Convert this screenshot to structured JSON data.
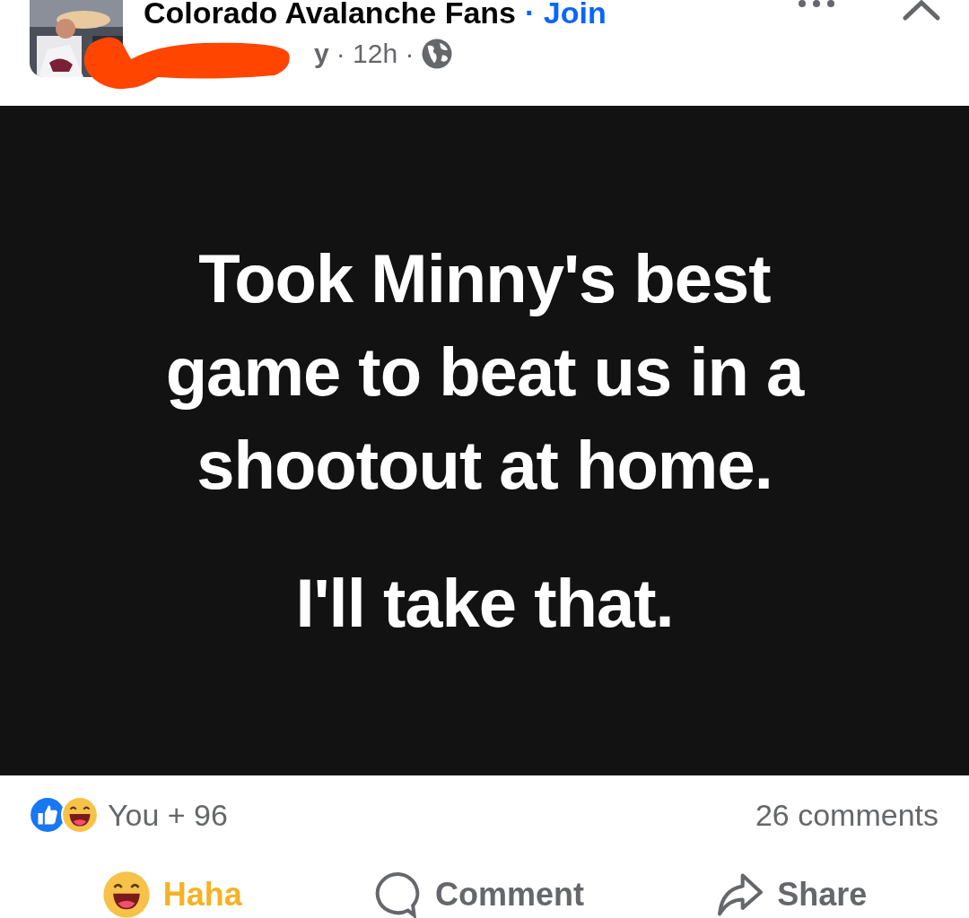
{
  "header": {
    "group_name": "Colorado Avalanche Fans",
    "join_link": "· Join",
    "author_visible": "y",
    "time": "· 12h ·"
  },
  "post": {
    "lines": [
      "Took Minny's best game to beat us in a shootout at home.",
      "I'll take that."
    ]
  },
  "reactions": {
    "summary": "You + 96",
    "comments": "26 comments"
  },
  "actions": [
    {
      "kind": "reaction",
      "label": "Haha",
      "active": true
    },
    {
      "kind": "comment",
      "label": "Comment",
      "active": false
    },
    {
      "kind": "share",
      "label": "Share",
      "active": false
    }
  ]
}
